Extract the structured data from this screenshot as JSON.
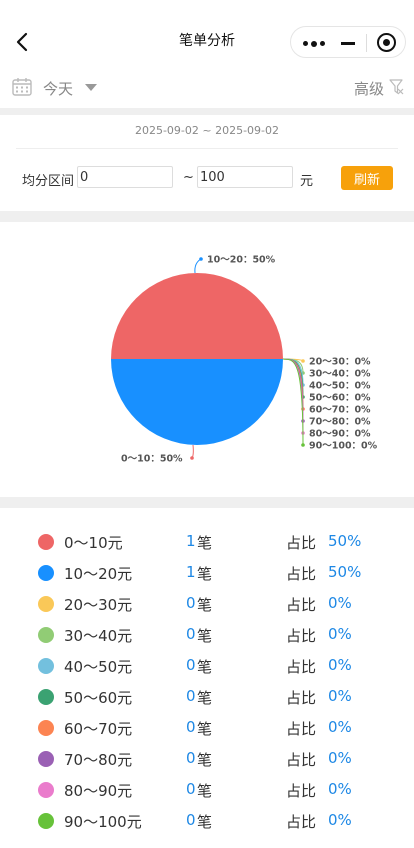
{
  "nav": {
    "title": "笔单分析"
  },
  "filter": {
    "period": "今天",
    "advanced": "高级"
  },
  "range": {
    "date_range": "2025-09-02 ~ 2025-09-02",
    "label": "均分区间",
    "min_value": "0",
    "max_value": "100",
    "tilde": "~",
    "unit": "元",
    "refresh_label": "刷新"
  },
  "colors": {
    "accent": "#f7a10b",
    "blue_value": "#1e88e5"
  },
  "chart_data": {
    "type": "pie",
    "categories": [
      "0～10",
      "10～20",
      "20～30",
      "30～40",
      "40～50",
      "50～60",
      "60～70",
      "70～80",
      "80～90",
      "90～100"
    ],
    "values": [
      50,
      50,
      0,
      0,
      0,
      0,
      0,
      0,
      0,
      0
    ],
    "labels": [
      "0～10：50%",
      "10～20：50%",
      "20～30：0%",
      "30～40：0%",
      "40～50：0%",
      "50～60：0%",
      "60～70：0%",
      "70～80：0%",
      "80～90：0%",
      "90～100：0%"
    ],
    "colors": [
      "#ee6666",
      "#1890ff",
      "#fac858",
      "#91cc75",
      "#73c0de",
      "#3ba272",
      "#fc8452",
      "#9a60b4",
      "#ea7ccc",
      "#67c23a"
    ]
  },
  "legend": [
    {
      "label": "0～10元",
      "count": "1",
      "unit": "笔",
      "ratio_label": "占比",
      "pct": "50%",
      "color": "#ee6666"
    },
    {
      "label": "10～20元",
      "count": "1",
      "unit": "笔",
      "ratio_label": "占比",
      "pct": "50%",
      "color": "#1890ff"
    },
    {
      "label": "20～30元",
      "count": "0",
      "unit": "笔",
      "ratio_label": "占比",
      "pct": "0%",
      "color": "#fac858"
    },
    {
      "label": "30～40元",
      "count": "0",
      "unit": "笔",
      "ratio_label": "占比",
      "pct": "0%",
      "color": "#91cc75"
    },
    {
      "label": "40～50元",
      "count": "0",
      "unit": "笔",
      "ratio_label": "占比",
      "pct": "0%",
      "color": "#73c0de"
    },
    {
      "label": "50～60元",
      "count": "0",
      "unit": "笔",
      "ratio_label": "占比",
      "pct": "0%",
      "color": "#3ba272"
    },
    {
      "label": "60～70元",
      "count": "0",
      "unit": "笔",
      "ratio_label": "占比",
      "pct": "0%",
      "color": "#fc8452"
    },
    {
      "label": "70～80元",
      "count": "0",
      "unit": "笔",
      "ratio_label": "占比",
      "pct": "0%",
      "color": "#9a60b4"
    },
    {
      "label": "80～90元",
      "count": "0",
      "unit": "笔",
      "ratio_label": "占比",
      "pct": "0%",
      "color": "#ea7ccc"
    },
    {
      "label": "90～100元",
      "count": "0",
      "unit": "笔",
      "ratio_label": "占比",
      "pct": "0%",
      "color": "#67c23a"
    }
  ]
}
